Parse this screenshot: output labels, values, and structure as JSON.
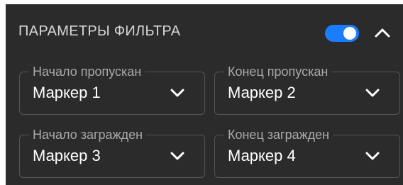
{
  "header": {
    "title": "ПАРАМЕТРЫ ФИЛЬТРА",
    "toggle_state": "on",
    "toggle_color": "#1a7dfd",
    "collapse_icon": "chevron-up-icon"
  },
  "fields": [
    {
      "label": "Начало пропускан",
      "value": "Маркер 1",
      "icon": "chevron-down-icon"
    },
    {
      "label": "Конец пропускан",
      "value": "Маркер 2",
      "icon": "chevron-down-icon"
    },
    {
      "label": "Начало загражден",
      "value": "Маркер 3",
      "icon": "chevron-down-icon"
    },
    {
      "label": "Конец загражден",
      "value": "Маркер 4",
      "icon": "chevron-down-icon"
    }
  ],
  "colors": {
    "panel_background": "#2b2b2b",
    "accent": "#1a7dfd"
  }
}
